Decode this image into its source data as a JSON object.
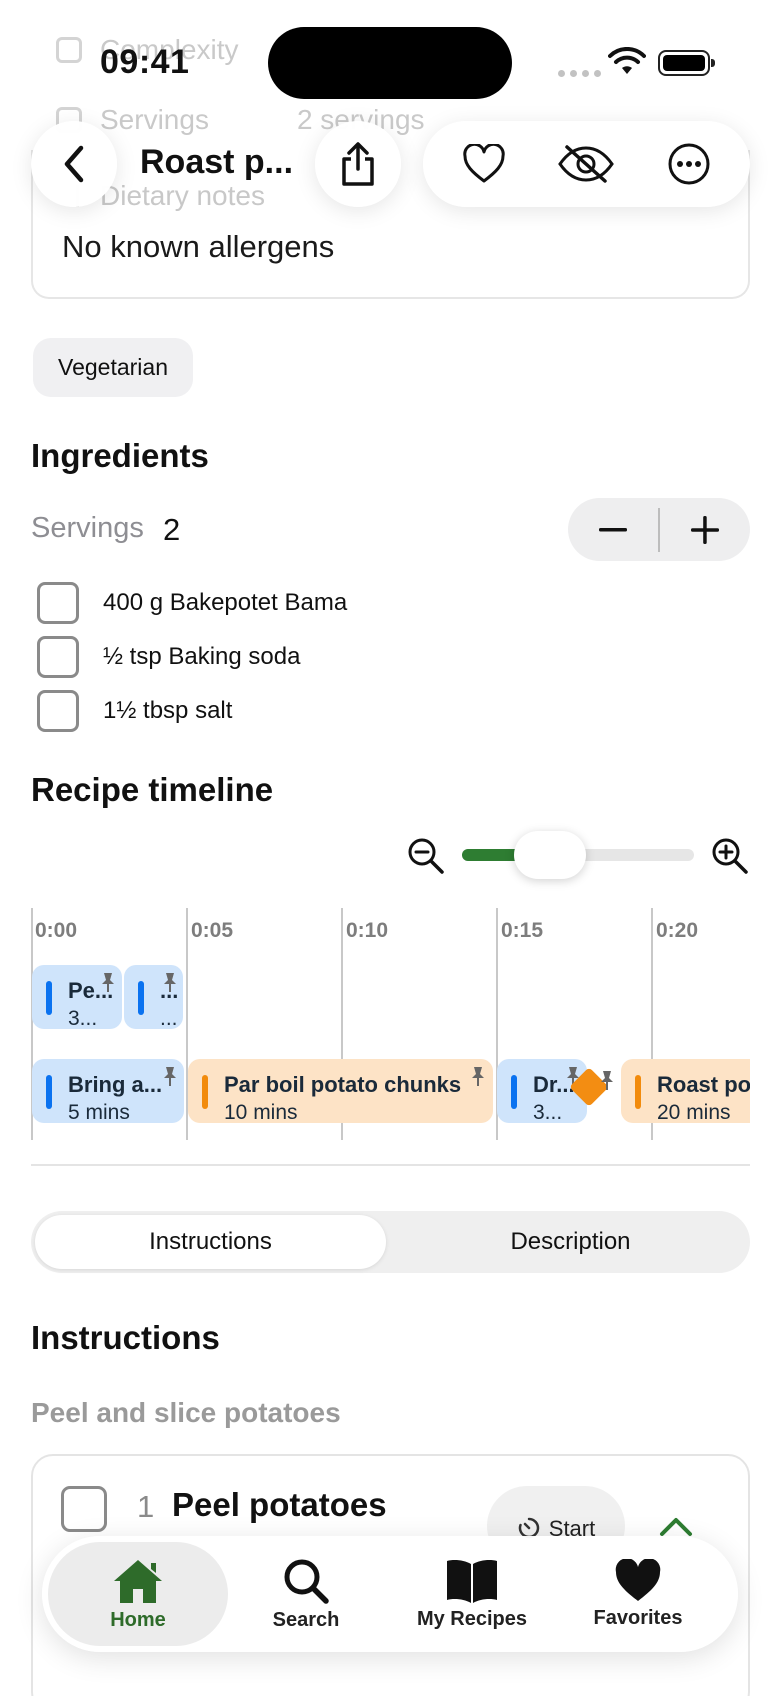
{
  "status_bar": {
    "time": "09:41"
  },
  "header": {
    "title": "Roast p..."
  },
  "faded_rows": [
    {
      "label": "Complexity"
    },
    {
      "label": "Servings",
      "value": "2 servings"
    }
  ],
  "dietary": {
    "title": "Dietary notes",
    "allergens": "No known allergens"
  },
  "tags": [
    "Vegetarian"
  ],
  "ingredients": {
    "title": "Ingredients",
    "servings_label": "Servings",
    "servings_value": "2",
    "minus": "−",
    "plus": "+",
    "items": [
      "400 g Bakepotet Bama",
      "½ tsp Baking soda",
      "1½ tbsp salt"
    ]
  },
  "timeline": {
    "title": "Recipe timeline",
    "zoom_level": 0.38,
    "ticks": [
      "0:00",
      "0:05",
      "0:10",
      "0:15",
      "0:20"
    ],
    "blocks": [
      {
        "title": "Pe...",
        "subtitle": "3...",
        "color": "blue"
      },
      {
        "title": "...",
        "subtitle": "...",
        "color": "blue"
      },
      {
        "title": "Bring a...",
        "subtitle": "5 mins",
        "color": "blue"
      },
      {
        "title": "Par boil potato chunks",
        "subtitle": "10 mins",
        "color": "orange"
      },
      {
        "title": "Dr...",
        "subtitle": "3...",
        "color": "blue"
      },
      {
        "title": "Roast po",
        "subtitle": "20 mins",
        "color": "orange"
      }
    ]
  },
  "segments": {
    "instructions": "Instructions",
    "description": "Description",
    "selected": "Instructions"
  },
  "instructions": {
    "title": "Instructions",
    "group": "Peel and slice potatoes",
    "steps": [
      {
        "number": "1",
        "title": "Peel potatoes",
        "start_label": "Start"
      }
    ]
  },
  "tabbar": {
    "items": [
      {
        "label": "Home",
        "icon": "home-icon",
        "active": true
      },
      {
        "label": "Search",
        "icon": "search-icon",
        "active": false
      },
      {
        "label": "My Recipes",
        "icon": "book-icon",
        "active": false
      },
      {
        "label": "Favorites",
        "icon": "heart-icon",
        "active": false
      }
    ]
  },
  "colors": {
    "accent_green": "#2e7d32",
    "timeline_blue": "#0a72f0",
    "timeline_orange": "#f28b0c"
  }
}
